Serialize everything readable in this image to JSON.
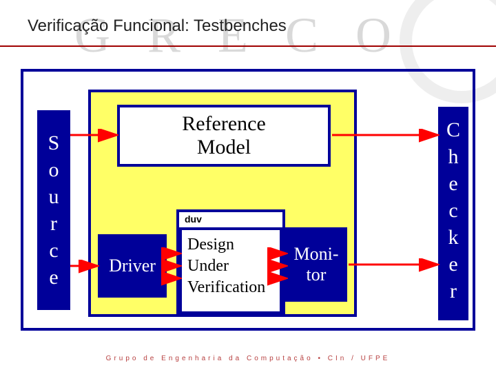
{
  "title": "Verificação Funcional: Testbenches",
  "bg_letters": "GRECO",
  "blocks": {
    "source": "Source",
    "checker": "Checker",
    "reference_model": "Reference\nModel",
    "driver": "Driver",
    "monitor": "Moni-\ntor",
    "duv_label": "duv",
    "duv_text": "Design\nUnder\nVerification"
  },
  "footer": "Grupo  de  Engenharia  da  Computação • CIn / UFPE",
  "chart_data": {
    "type": "diagram",
    "title": "Verificação Funcional: Testbenches",
    "nodes": [
      {
        "id": "source",
        "label": "Source"
      },
      {
        "id": "driver",
        "label": "Driver"
      },
      {
        "id": "refmodel",
        "label": "Reference Model"
      },
      {
        "id": "duv",
        "label": "Design Under Verification"
      },
      {
        "id": "monitor",
        "label": "Monitor"
      },
      {
        "id": "checker",
        "label": "Checker"
      }
    ],
    "groups": [
      {
        "id": "testbench_env",
        "contains": [
          "driver",
          "refmodel",
          "duv",
          "monitor"
        ],
        "color": "#ffff66"
      }
    ],
    "edges": [
      {
        "from": "source",
        "to": "driver"
      },
      {
        "from": "driver",
        "to": "duv"
      },
      {
        "from": "duv",
        "to": "monitor"
      },
      {
        "from": "source",
        "to": "refmodel"
      },
      {
        "from": "refmodel",
        "to": "checker"
      },
      {
        "from": "monitor",
        "to": "checker"
      }
    ]
  }
}
